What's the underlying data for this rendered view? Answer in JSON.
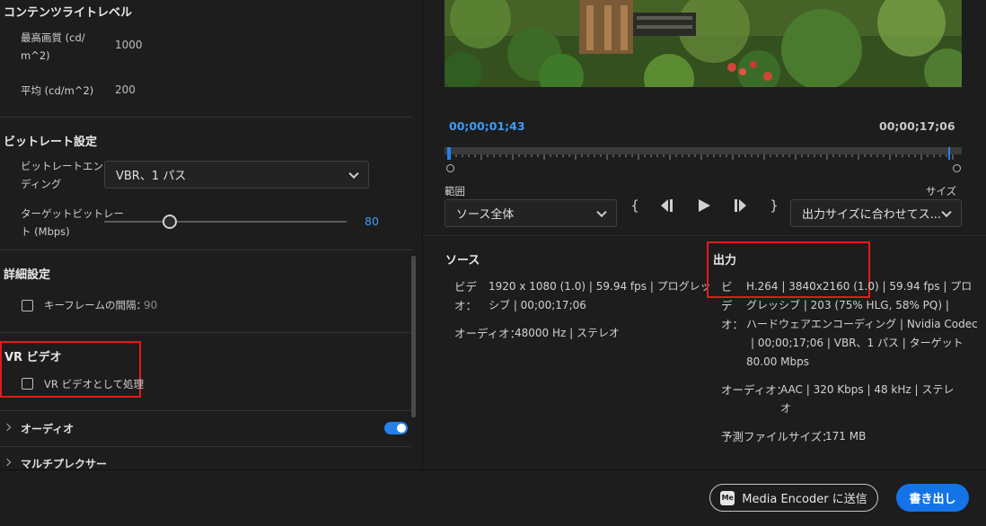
{
  "left": {
    "content_light": {
      "title": "コンテンツライトレベル",
      "max_quality_label_line1": "最高画質 (cd/",
      "max_quality_label_line2": "m^2)",
      "max_quality_value": "1000",
      "avg_label": "平均 (cd/m^2)",
      "avg_value": "200"
    },
    "bitrate": {
      "title": "ビットレート設定",
      "encoding_label_line1": "ビットレートエンコー",
      "encoding_label_line2": "ディング",
      "encoding_value": "VBR、1 パス",
      "target_label_line1": "ターゲットビットレー",
      "target_label_line2": "ト (Mbps)",
      "target_value": "80",
      "target_slider_fraction": 0.27
    },
    "advanced": {
      "title": "詳細設定",
      "keyframe_label": "キーフレームの間隔：",
      "keyframe_value": "90"
    },
    "vr": {
      "title": "VR ビデオ",
      "process_label": "VR ビデオとして処理"
    },
    "audio": {
      "title": "オーディオ"
    },
    "multiplexer": {
      "title": "マルチプレクサー"
    }
  },
  "preview": {
    "current_timecode": "00;00;01;43",
    "duration_timecode": "00;00;17;06",
    "range_label": "範囲",
    "range_value": "ソース全体",
    "size_label": "サイズ",
    "size_value": "出力サイズに合わせてス...",
    "playhead_fraction": 0.005
  },
  "source": {
    "title": "ソース",
    "video_label_line1": "ビデ",
    "video_label_line2": "オ：",
    "video_line1": "1920 x 1080 (1.0) | 59.94 fps | プログレッ",
    "video_line2": "シブ | 00;00;17;06",
    "audio_label": "オーディオ：",
    "audio_value": "48000 Hz | ステレオ"
  },
  "output": {
    "title": "出力",
    "video_label_line1": "ビ",
    "video_label_line2": "デ",
    "video_label_line3": "オ：",
    "video_line1": "H.264 | 3840x2160 (1.0) | 59.94 fps | プロ",
    "video_line2": "グレッシブ | 203 (75% HLG, 58% PQ) |",
    "video_line3": "ハードウェアエンコーディング | Nvidia Codec",
    "video_line4": "| 00;00;17;06 | VBR、1 パス | ターゲット",
    "video_line5": "80.00 Mbps",
    "audio_label": "オーディオ：",
    "audio_line1": "AAC | 320 Kbps | 48 kHz | ステレ",
    "audio_line2": "オ",
    "filesize_label": "予測ファイルサイズ：",
    "filesize_value": "171 MB"
  },
  "footer": {
    "me_icon_text": "Me",
    "send_label": "Media Encoder に送信",
    "export_label": "書き出し"
  },
  "colors": {
    "accent": "#1473e6",
    "timecode_blue": "#3e9bf5",
    "highlight_red": "#e21b1b",
    "background": "#1d1d1d"
  },
  "icons": {
    "range_select": "chevron-down-icon",
    "size_select": "chevron-down-icon",
    "in_point": "in-brace-icon",
    "step_back": "step-back-icon",
    "play": "play-icon",
    "step_forward": "step-forward-icon",
    "out_point": "out-brace-icon"
  }
}
